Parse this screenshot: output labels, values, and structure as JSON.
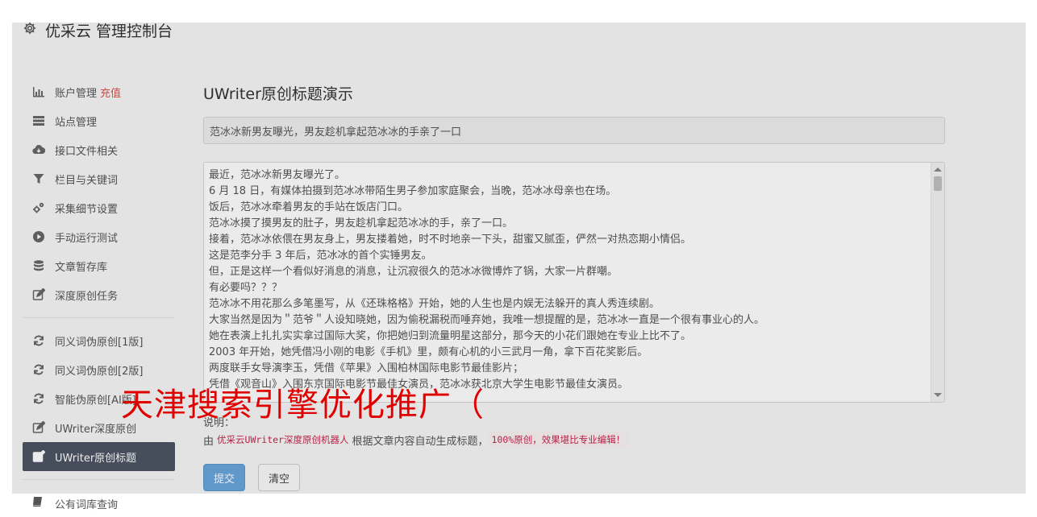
{
  "header": {
    "title": "优采云 管理控制台",
    "icon": "gear-icon"
  },
  "sidebar": {
    "items": [
      {
        "label": "账户管理",
        "badge": "充值",
        "icon": "bar-chart-icon"
      },
      {
        "label": "站点管理",
        "icon": "server-icon"
      },
      {
        "label": "接口文件相关",
        "icon": "cloud-download-icon"
      },
      {
        "label": "栏目与关键词",
        "icon": "filter-icon"
      },
      {
        "label": "采集细节设置",
        "icon": "gears-icon"
      },
      {
        "label": "手动运行测试",
        "icon": "play-circle-icon"
      },
      {
        "label": "文章暂存库",
        "icon": "database-icon"
      },
      {
        "label": "深度原创任务",
        "icon": "edit-icon"
      },
      {
        "label": "同义词伪原创[1版]",
        "icon": "refresh-icon"
      },
      {
        "label": "同义词伪原创[2版]",
        "icon": "refresh-icon"
      },
      {
        "label": "智能伪原创[AI版]",
        "icon": "refresh-icon"
      },
      {
        "label": "UWriter深度原创",
        "icon": "edit-icon"
      },
      {
        "label": "UWriter原创标题",
        "icon": "edit-icon",
        "active": true
      },
      {
        "label": "公有词库查询",
        "icon": "book-icon"
      }
    ]
  },
  "main": {
    "title": "UWriter原创标题演示",
    "title_input_value": "范冰冰新男友曝光，男友趁机拿起范冰冰的手亲了一口",
    "content_lines": [
      "最近，范冰冰新男友曝光了。",
      "6 月 18 日，有媒体拍摄到范冰冰带陌生男子参加家庭聚会，当晚，范冰冰母亲也在场。",
      "饭后，范冰冰牵着男友的手站在饭店门口。",
      "范冰冰摸了摸男友的肚子，男友趁机拿起范冰冰的手，亲了一口。",
      "接着，范冰冰依偎在男友身上，男友搂着她，时不时地亲一下头，甜蜜又腻歪，俨然一对热恋期小情侣。",
      "这是范李分手 3 年后，范冰冰的首个实锤男友。",
      "但，正是这样一个看似好消息的消息，让沉寂很久的范冰冰微博炸了锅，大家一片群嘲。",
      "有必要吗？？？",
      "范冰冰不用花那么多笔墨写，从《还珠格格》开始，她的人生也是内娱无法躲开的真人秀连续剧。",
      "大家当然是因为＂范爷＂人设知晓她，因为偷税漏税而唾弃她，我唯一想提醒的是，范冰冰一直是一个很有事业心的人。",
      "她在表演上扎扎实实拿过国际大奖，你把她归到流量明星这部分，那今天的小花们跟她在专业上比不了。",
      "2003 年开始，她凭借冯小刚的电影《手机》里，颇有心机的小三武月一角，拿下百花奖影后。",
      "两度联手女导演李玉，凭借《苹果》入围柏林国际电影节最佳影片；",
      "凭借《观音山》入围东京国际电影节最佳女演员，范冰冰获北京大学生电影节最佳女演员。"
    ],
    "note_label": "说明：",
    "note_prefix": "由",
    "note_code1": "优采云UWriter深度原创机器人",
    "note_middle": "根据文章内容自动生成标题，",
    "note_code2": "100%原创，效果堪比专业编辑！",
    "submit_label": "提交",
    "clear_label": "清空"
  },
  "watermark": "天津搜索引擎优化推广（",
  "colors": {
    "accent": "#6aa5dc",
    "active_nav": "#4d5563",
    "badge": "#d9534f",
    "code": "#c7254e"
  }
}
